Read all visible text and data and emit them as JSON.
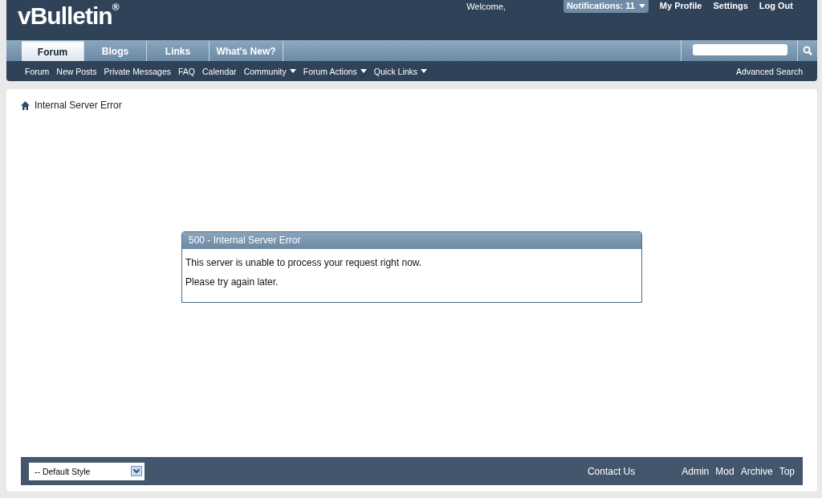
{
  "header": {
    "logo": "vBulletin",
    "logo_mark": "®",
    "welcome": "Welcome,",
    "notifications": "Notifications: 11",
    "user_links": [
      "My Profile",
      "Settings",
      "Log Out"
    ]
  },
  "tabs": [
    {
      "label": "Forum",
      "selected": true
    },
    {
      "label": "Blogs",
      "selected": false
    },
    {
      "label": "Links",
      "selected": false
    },
    {
      "label": "What's New?",
      "selected": false
    }
  ],
  "sub_nav": [
    {
      "label": "Forum",
      "dropdown": false
    },
    {
      "label": "New Posts",
      "dropdown": false
    },
    {
      "label": "Private Messages",
      "dropdown": false
    },
    {
      "label": "FAQ",
      "dropdown": false
    },
    {
      "label": "Calendar",
      "dropdown": false
    },
    {
      "label": "Community",
      "dropdown": true
    },
    {
      "label": "Forum Actions",
      "dropdown": true
    },
    {
      "label": "Quick Links",
      "dropdown": true
    }
  ],
  "advanced_search": "Advanced Search",
  "breadcrumb": "Internal Server Error",
  "error_box": {
    "title": "500 - Internal Server Error",
    "lines": [
      "This server is unable to process your request right now.",
      "Please try again later."
    ]
  },
  "footer": {
    "style_select": "-- Default Style",
    "contact": "Contact Us",
    "links": [
      "Admin",
      "Mod",
      "Archive",
      "Top"
    ]
  }
}
